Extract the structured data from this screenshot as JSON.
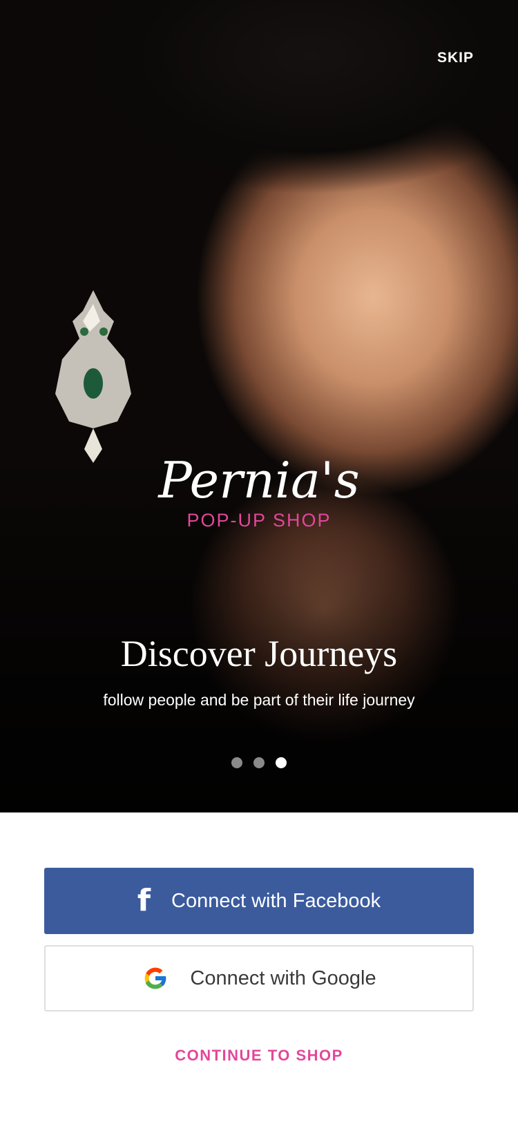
{
  "header": {
    "skip_label": "SKIP"
  },
  "brand": {
    "script_name": "Pernia's",
    "subtitle": "POP-UP SHOP",
    "accent": "#e2479a"
  },
  "onboarding": {
    "title": "Discover Journeys",
    "description": "follow people and be part of their life journey",
    "page_count": 3,
    "active_page": 3
  },
  "actions": {
    "facebook_label": "Connect with Facebook",
    "facebook_color": "#3b5b9d",
    "facebook_icon": "facebook-icon",
    "google_label": "Connect with Google",
    "google_icon": "google-icon",
    "continue_label": "CONTINUE TO SHOP"
  }
}
